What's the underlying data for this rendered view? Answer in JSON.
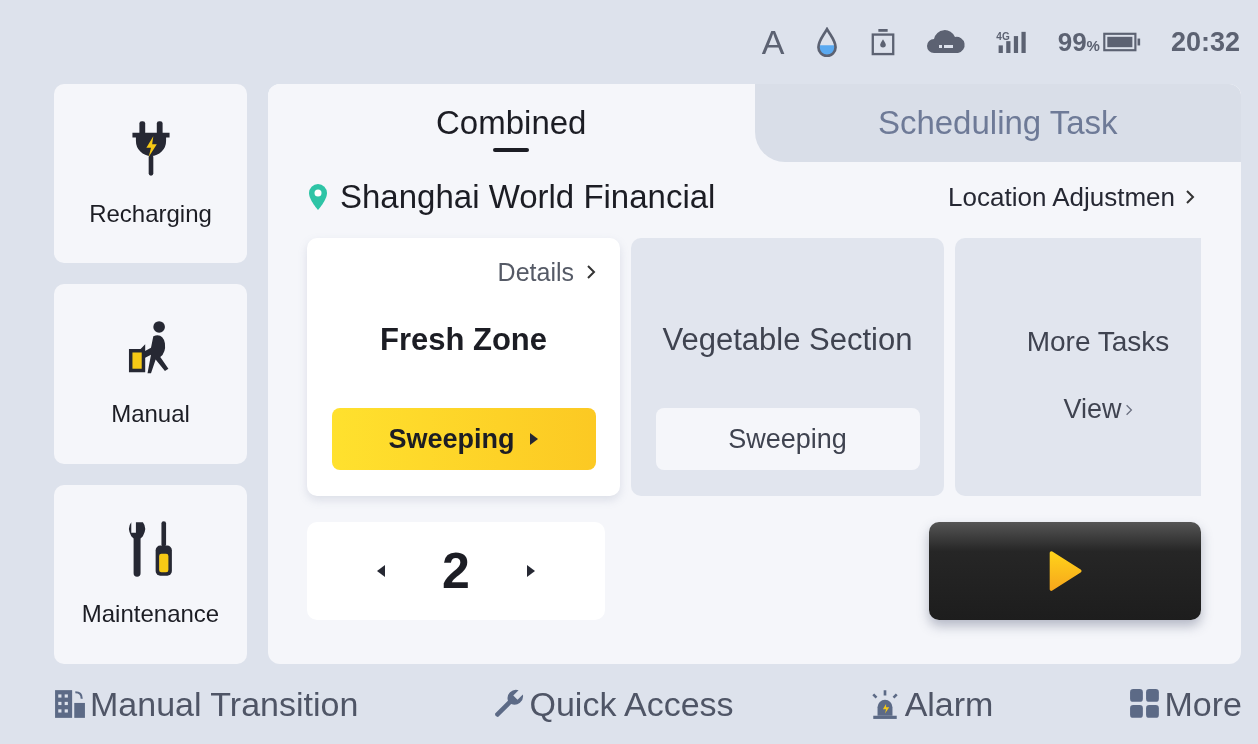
{
  "status_bar": {
    "input_mode": "A",
    "network": "4G",
    "battery_percent": "99",
    "percent_sign": "%",
    "time": "20:32"
  },
  "sidebar": {
    "items": [
      {
        "label": "Recharging",
        "kind": "plug"
      },
      {
        "label": "Manual",
        "kind": "push"
      },
      {
        "label": "Maintenance",
        "kind": "tools"
      }
    ]
  },
  "tabs": [
    {
      "label": "Combined",
      "selected": true
    },
    {
      "label": "Scheduling Task",
      "selected": false
    }
  ],
  "location": {
    "name": "Shanghai World Financial",
    "action": "Location Adjustmen"
  },
  "task_cards": [
    {
      "details": "Details",
      "title": "Fresh Zone",
      "mode": "Sweeping",
      "selected": true
    },
    {
      "title": "Vegetable Section",
      "mode": "Sweeping",
      "selected": false
    }
  ],
  "more_card": {
    "title": "More Tasks",
    "link": "View"
  },
  "pager": {
    "value": "2"
  },
  "bottom_bar": [
    {
      "label": "Manual Transition",
      "kind": "building"
    },
    {
      "label": "Quick Access",
      "kind": "wrench"
    },
    {
      "label": "Alarm",
      "kind": "beacon"
    },
    {
      "label": "More",
      "kind": "grid"
    }
  ]
}
